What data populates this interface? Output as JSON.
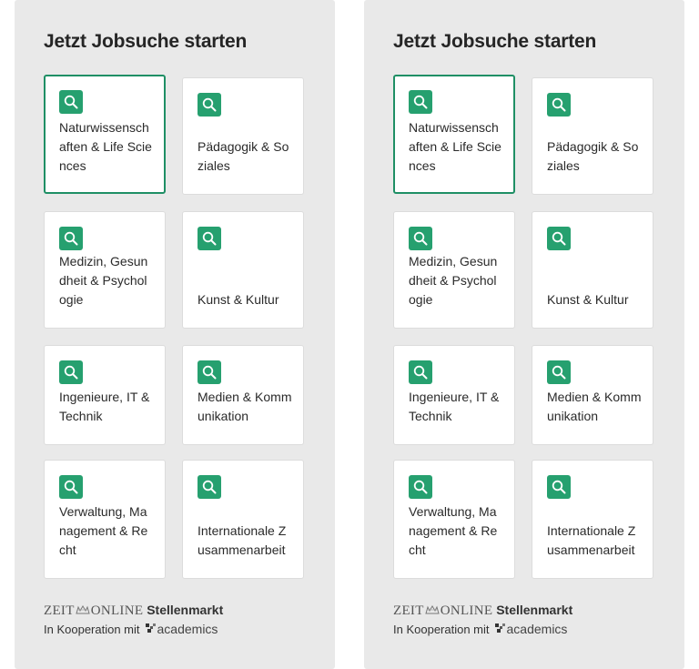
{
  "panels": [
    {
      "title": "Jetzt Jobsuche starten",
      "tiles": [
        {
          "label": "Naturwissenschaften & Life Sciences",
          "active": true
        },
        {
          "label": "Pädagogik & Soziales"
        },
        {
          "label": "Medizin, Gesundheit & Psychologie"
        },
        {
          "label": "Kunst & Kultur"
        },
        {
          "label": "Ingenieure, IT & Technik"
        },
        {
          "label": "Medien & Kommunikation"
        },
        {
          "label": "Verwaltung, Management & Recht"
        },
        {
          "label": "Internationale Zusammenarbeit"
        }
      ],
      "footer": {
        "brand_zeit": "ZEIT",
        "brand_online": "ONLINE",
        "brand_stellenmarkt": "Stellenmarkt",
        "coop_text": "In Kooperation mit",
        "partner": "academics"
      }
    },
    {
      "title": "Jetzt Jobsuche starten",
      "tiles": [
        {
          "label": "Naturwissenschaften & Life Sciences",
          "active": true
        },
        {
          "label": "Pädagogik & Soziales"
        },
        {
          "label": "Medizin, Gesundheit & Psychologie"
        },
        {
          "label": "Kunst & Kultur"
        },
        {
          "label": "Ingenieure, IT & Technik"
        },
        {
          "label": "Medien & Kommunikation"
        },
        {
          "label": "Verwaltung, Management & Recht"
        },
        {
          "label": "Internationale Zusammenarbeit"
        }
      ],
      "footer": {
        "brand_zeit": "ZEIT",
        "brand_online": "ONLINE",
        "brand_stellenmarkt": "Stellenmarkt",
        "coop_text": "In Kooperation mit",
        "partner": "academics"
      }
    }
  ],
  "icons": {
    "tile": "search-icon",
    "crest": "zeit-crest-icon",
    "partner": "academics-logo-icon"
  },
  "colors": {
    "accent": "#26a06f",
    "active_border": "#1f8f65",
    "panel_bg": "#e9e9e9"
  }
}
